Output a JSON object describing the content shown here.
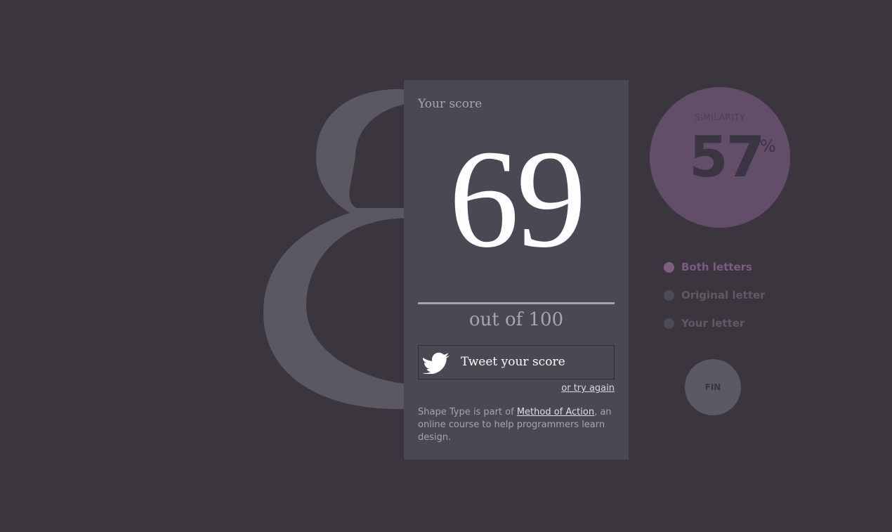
{
  "background_letter": {
    "glyph": "8",
    "color": "#5a5860"
  },
  "score_panel": {
    "title": "Your score",
    "score": "69",
    "out_of": "out of 100",
    "tweet_button": {
      "label": "Tweet your score",
      "icon": "twitter-bird-icon"
    },
    "try_again": "or try again",
    "footer": {
      "prefix": "Shape Type is part of ",
      "link_text": "Method of Action",
      "suffix": ", an online course to help programmers learn design."
    }
  },
  "similarity": {
    "label": "SIMILARITY",
    "value": "57",
    "unit": "%",
    "color": "#634e6a"
  },
  "legend": {
    "items": [
      {
        "label": "Both letters",
        "selected": true,
        "dot_color": "#7d5f86",
        "text_color": "#7a5b84"
      },
      {
        "label": "Original letter",
        "selected": false,
        "dot_color": "#4c4a52",
        "text_color": "#5d5b63"
      },
      {
        "label": "Your letter",
        "selected": false,
        "dot_color": "#4c4a52",
        "text_color": "#5d5b63"
      }
    ]
  },
  "fin_button": {
    "label": "FIN"
  }
}
